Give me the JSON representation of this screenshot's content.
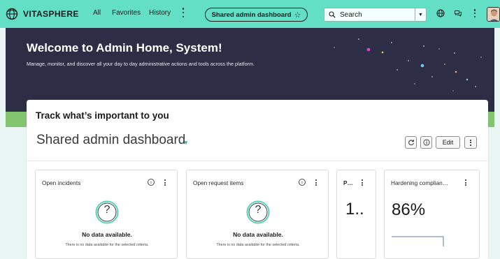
{
  "brand": {
    "name": "VITASPHERE",
    "logo": "globe-leaf-logo"
  },
  "nav": {
    "items": [
      "All",
      "Favorites",
      "History"
    ],
    "pinned_tab": "Shared admin dashboard",
    "search_placeholder": "Search",
    "icons": [
      "globe-icon",
      "chat-icon",
      "more-icon",
      "avatar"
    ]
  },
  "hero": {
    "title": "Welcome to Admin Home, System!",
    "subtitle": "Manage, monitor, and discover all your day to day administrative actions and tools across the platform."
  },
  "card": {
    "heading": "Track what’s important to you",
    "dashboard_name": "Shared admin dashboard",
    "edit_label": "Edit"
  },
  "widgets": [
    {
      "title": "Open incidents",
      "state": "No data available.",
      "detail": "There is no data available for the selected criteria."
    },
    {
      "title": "Open request items",
      "state": "No data available.",
      "detail": "There is no data available for the selected criteria."
    },
    {
      "title": "P…",
      "value": "1.."
    },
    {
      "title": "Hardening complian…",
      "value": "86%"
    }
  ],
  "colors": {
    "topbar": "#63dfc6",
    "hero": "#2d2e45",
    "accent": "#28b59c",
    "band": "#83c46e"
  }
}
